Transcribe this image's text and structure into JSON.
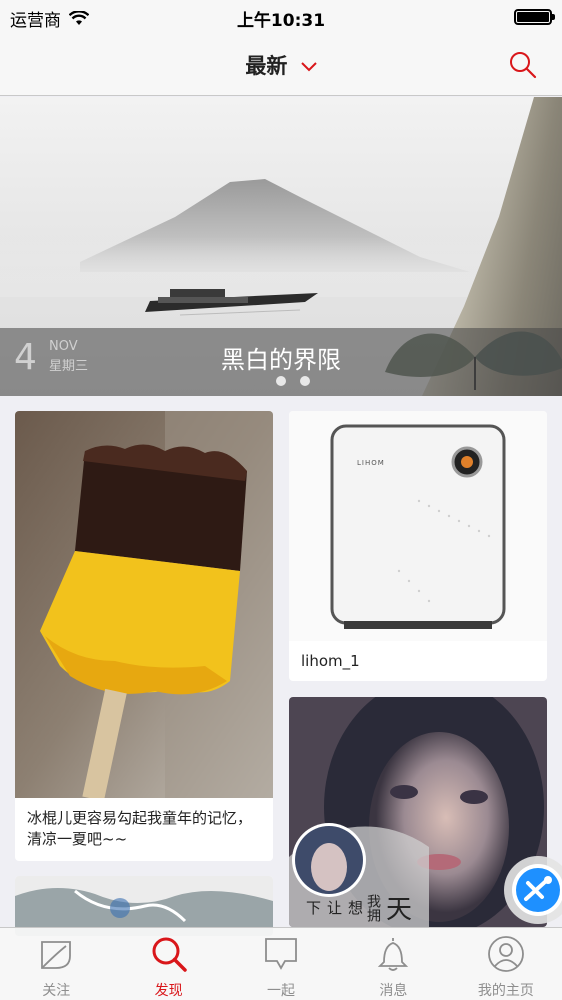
{
  "status_bar": {
    "carrier": "运营商",
    "time": "上午10:31"
  },
  "nav": {
    "title": "最新"
  },
  "banner": {
    "day": "4",
    "month": "NOV",
    "weekday": "星期三",
    "title": "黑白的界限"
  },
  "cards": [
    {
      "caption": "冰棍儿更容易勾起我童年的记忆，清凉一夏吧~~"
    },
    {
      "caption": "lihom_1",
      "brand_text": "LIHOM"
    },
    {
      "caption": "想让下",
      "overlay_text": "我拥",
      "overlay_text2": "天"
    }
  ],
  "tabs": [
    {
      "label": "关注"
    },
    {
      "label": "发现"
    },
    {
      "label": "一起"
    },
    {
      "label": "消息"
    },
    {
      "label": "我的主页"
    }
  ],
  "colors": {
    "accent": "#d9161a",
    "tab_inactive": "#8e8e8e",
    "float_button": "#1e90ff"
  }
}
